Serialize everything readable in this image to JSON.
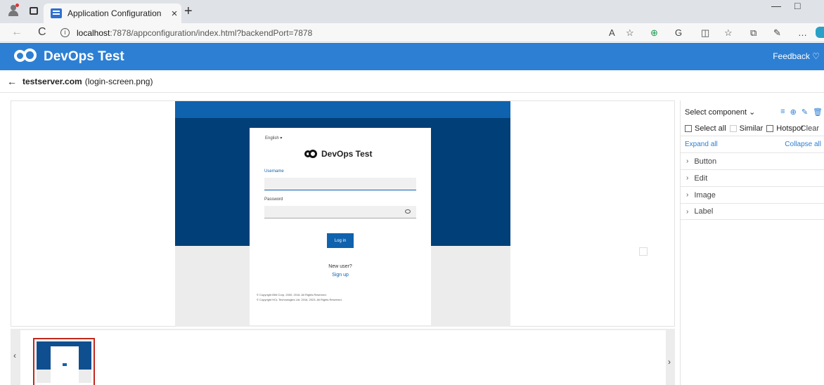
{
  "browser": {
    "tab_title": "Application Configuration",
    "tab_close": "×",
    "new_tab": "+",
    "url_host": "localhost",
    "url_path": ":7878/appconfiguration/index.html?backendPort=7878",
    "info_glyph": "i",
    "back_glyph": "←",
    "reload_glyph": "C",
    "minimize_glyph": "—",
    "restore_glyph": "□",
    "toolbar_icons": [
      "read-aloud-icon",
      "favorite-star-icon",
      "extension-icon",
      "refresh-extension-icon",
      "split-screen-icon",
      "favorites-list-icon",
      "collections-icon",
      "copilot-icon",
      "more-icon"
    ],
    "toolbar_glyphs": [
      "A",
      "☆",
      "⊕",
      "G",
      "◫",
      "☆",
      "⧉",
      "✎",
      "…"
    ]
  },
  "app": {
    "title": "DevOps Test",
    "feedback": "Feedback",
    "feedback_glyph": "♡",
    "accent": "#2d7fd3"
  },
  "breadcrumb": {
    "back": "←",
    "server": "testserver.com",
    "file": "(login-screen.png)"
  },
  "preview": {
    "language": "English ▾",
    "brand": "DevOps Test",
    "username_label": "Username",
    "password_label": "Password",
    "login_button": "Log in",
    "new_user": "New user?",
    "sign_up": "Sign up",
    "copyright_1": "© Copyright IBM Corp. 2000, 2016. All Rights Reserved.",
    "copyright_2": "© Copyright HCL Technologies Ltd. 2016, 2023. All Rights Reserved."
  },
  "strip": {
    "prev": "‹",
    "next": "›"
  },
  "panel": {
    "select_component": "Select component ⌄",
    "icons": [
      "≡",
      "⊕",
      "✎",
      "🗑"
    ],
    "select_all": "Select all",
    "similar": "Similar",
    "hotspot": "Hotspot",
    "clear": "Clear",
    "expand_all": "Expand all",
    "collapse_all": "Collapse all",
    "chevron": "›",
    "categories": [
      "Button",
      "Edit",
      "Image",
      "Label"
    ]
  }
}
